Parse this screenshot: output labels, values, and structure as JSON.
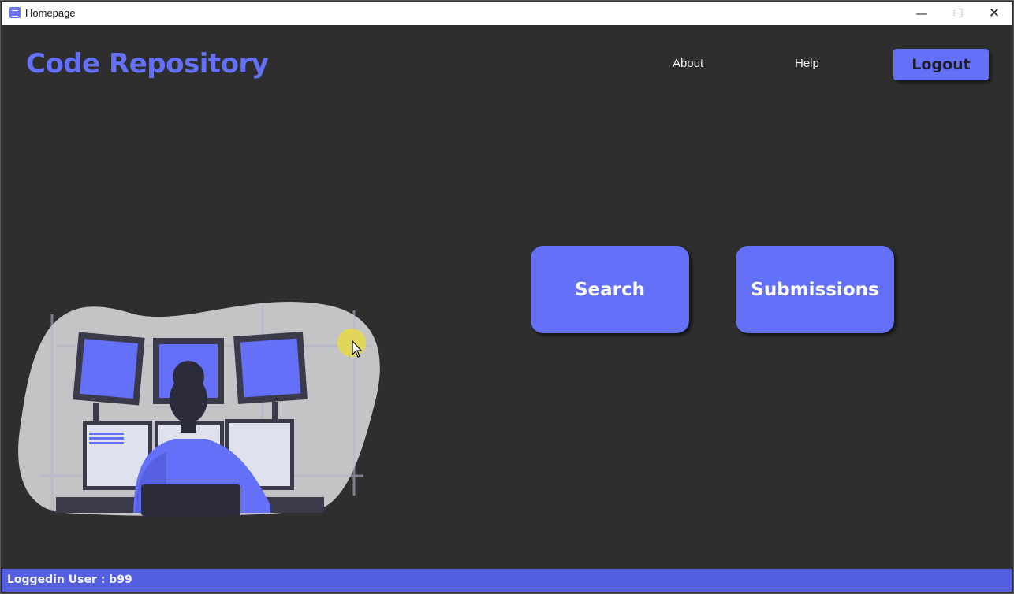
{
  "window": {
    "title": "Homepage",
    "controls": {
      "minimize": "—",
      "maximize": "☐",
      "close": "✕"
    }
  },
  "header": {
    "brand": "Code Repository",
    "nav": {
      "about": "About",
      "help": "Help"
    },
    "logout_label": "Logout"
  },
  "actions": {
    "search_label": "Search",
    "submissions_label": "Submissions"
  },
  "illustration": {
    "icon": "developer-at-monitors-illustration"
  },
  "status": {
    "text": "Loggedin User : b99"
  },
  "colors": {
    "accent": "#6370f7",
    "background": "#2e2e2e",
    "statusbar": "#535fe0"
  }
}
